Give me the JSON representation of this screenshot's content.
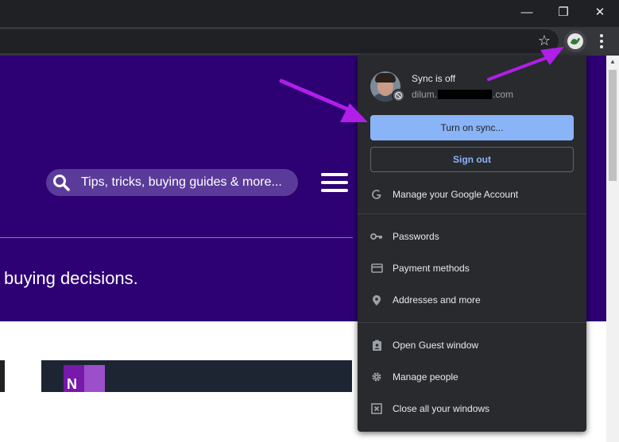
{
  "window": {
    "minimize_glyph": "—",
    "restore_glyph": "❐",
    "close_glyph": "✕"
  },
  "toolbar": {
    "star_glyph": "☆"
  },
  "page": {
    "search_placeholder": "Tips, tricks, buying guides & more...",
    "tagline": "buying decisions.",
    "thumb_letter": "N"
  },
  "profile_menu": {
    "sync_status": "Sync is off",
    "email_prefix": "dilum.",
    "email_suffix": ".com",
    "turn_on_sync": "Turn on sync...",
    "sign_out": "Sign out",
    "items": [
      {
        "label": "Manage your Google Account",
        "icon": "google-g-icon"
      },
      {
        "label": "Passwords",
        "icon": "key-icon"
      },
      {
        "label": "Payment methods",
        "icon": "credit-card-icon"
      },
      {
        "label": "Addresses and more",
        "icon": "location-pin-icon"
      },
      {
        "label": "Open Guest window",
        "icon": "guest-badge-icon"
      },
      {
        "label": "Manage people",
        "icon": "gear-icon"
      },
      {
        "label": "Close all your windows",
        "icon": "close-window-icon"
      }
    ]
  },
  "colors": {
    "hero_bg": "#2d0073",
    "menu_bg": "#292a2d",
    "accent_blue": "#8ab4f8",
    "annotation_arrow": "#b01ee8"
  }
}
